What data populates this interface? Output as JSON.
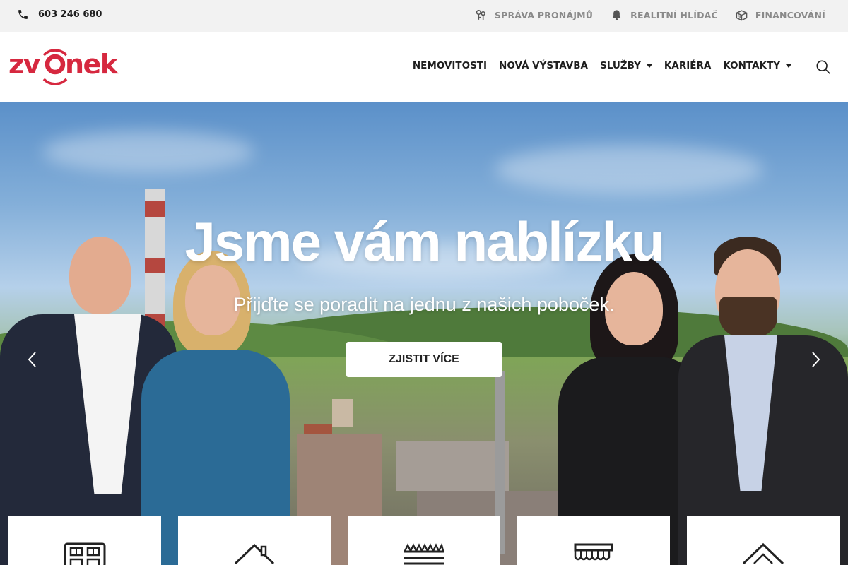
{
  "topbar": {
    "phone": "603 246 680",
    "links": [
      {
        "label": "SPRÁVA PRONÁJMŮ",
        "icon": "keys-icon"
      },
      {
        "label": "REALITNÍ HLÍDAČ",
        "icon": "bell-icon"
      },
      {
        "label": "FINANCOVÁNÍ",
        "icon": "money-icon"
      }
    ]
  },
  "header": {
    "logo_text": "zvonek",
    "brand_color": "#d6283f",
    "nav": [
      {
        "label": "NEMOVITOSTI"
      },
      {
        "label": "NOVÁ VÝSTAVBA"
      },
      {
        "label": "SLUŽBY",
        "dropdown": true
      },
      {
        "label": "KARIÉRA"
      },
      {
        "label": "KONTAKTY",
        "dropdown": true
      }
    ],
    "search_icon": "search-icon"
  },
  "hero": {
    "title": "Jsme vám nablízku",
    "subtitle": "Přijďte se poradit na jednu z našich poboček.",
    "button": "ZJISTIT VÍCE",
    "prev_icon": "chevron-left-icon",
    "next_icon": "chevron-right-icon"
  },
  "cards": [
    {
      "icon": "apartment-building-icon"
    },
    {
      "icon": "house-icon"
    },
    {
      "icon": "fence-icon"
    },
    {
      "icon": "shop-awning-icon"
    },
    {
      "icon": "cottage-icon"
    }
  ]
}
